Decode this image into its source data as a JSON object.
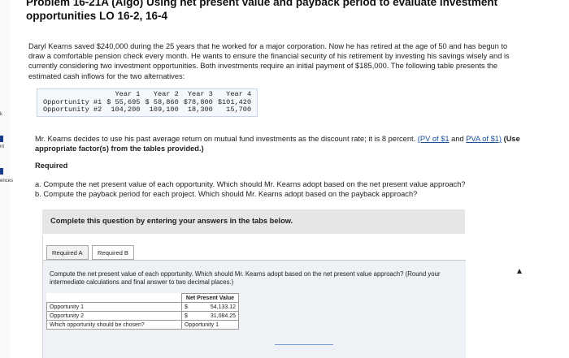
{
  "left_rail": {
    "items": [
      "k",
      "nt",
      "ences"
    ]
  },
  "title": "Problem 16-21A (Algo) Using net present value and payback period to evaluate investment opportunities LO 16-2, 16-4",
  "intro": "Daryl Kearns saved $240,000 during the 25 years that he worked for a major corporation. Now he has retired at the age of 50 and has begun to draw a comfortable pension check every month. He wants to ensure the financial security of his retirement by investing his savings wisely and is currently considering two investment opportunities. Both investments require an initial payment of $185,000. The following table presents the estimated cash inflows for the two alternatives:",
  "cash_flows": {
    "headers": [
      "",
      "Year 1",
      "Year 2",
      "Year 3",
      "Year 4"
    ],
    "rows": [
      [
        "Opportunity #1",
        "$ 55,695",
        "$ 58,860",
        "$78,800",
        "$101,420"
      ],
      [
        "Opportunity #2",
        "104,200",
        "109,100",
        "18,300",
        "15,700"
      ]
    ]
  },
  "discount": {
    "text": "Mr. Kearns decides to use his past average return on mutual fund investments as the discount rate; it is 8 percent.",
    "link1": "(PV of $1",
    "and": "and",
    "link2": "PVA of $1)",
    "bold_text": "(Use appropriate factor(s) from the tables provided.)"
  },
  "required_heading": "Required",
  "tasks": {
    "a": "a. Compute the net present value of each opportunity. Which should Mr. Kearns adopt based on the net present value approach?",
    "b": "b. Compute the payback period for each project. Which should Mr. Kearns adopt based on the payback approach?"
  },
  "instruction": "Complete this question by entering your answers in the tabs below.",
  "tabs": [
    {
      "label": "Required A"
    },
    {
      "label": "Required B"
    }
  ],
  "question_text": "Compute the net present value of each opportunity. Which should Mr. Kearns adopt based on the net present value approach? (Round your intermediate calculations and final answer to two decimal places.)",
  "answer_table": {
    "header": "Net Present Value",
    "rows": [
      {
        "label": "Opportunity 1",
        "currency": "$",
        "value": "54,133.12"
      },
      {
        "label": "Opportunity 2",
        "currency": "$",
        "value": "31,084.25"
      }
    ],
    "choice_label": "Which opportunity should be chosen?",
    "choice_value": "Opportunity 1"
  }
}
